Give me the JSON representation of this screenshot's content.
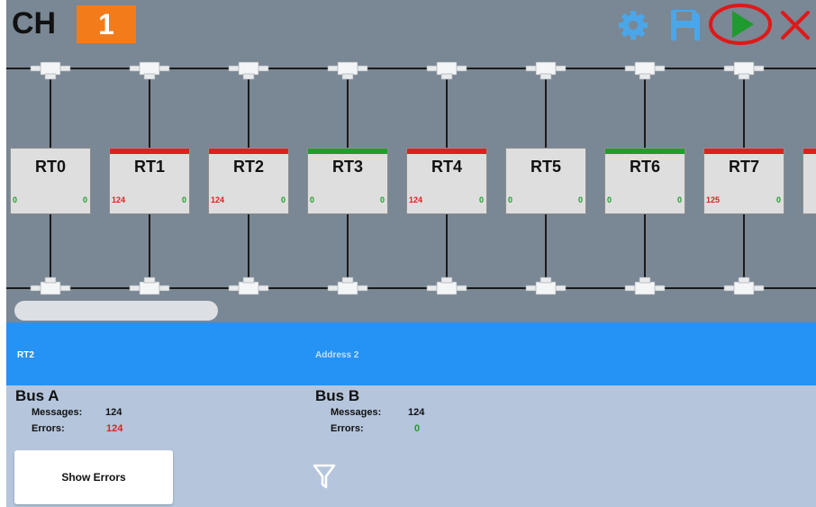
{
  "header": {
    "channel_label": "CH",
    "channel_number": "1",
    "icons": [
      "gear-icon",
      "save-icon",
      "play-icon",
      "close-icon"
    ]
  },
  "rts": [
    {
      "name": "RT0",
      "left_count": "0",
      "right_count": "0",
      "status": "none"
    },
    {
      "name": "RT1",
      "left_count": "124",
      "right_count": "0",
      "status": "error"
    },
    {
      "name": "RT2",
      "left_count": "124",
      "right_count": "0",
      "status": "error"
    },
    {
      "name": "RT3",
      "left_count": "0",
      "right_count": "0",
      "status": "ok"
    },
    {
      "name": "RT4",
      "left_count": "124",
      "right_count": "0",
      "status": "error"
    },
    {
      "name": "RT5",
      "left_count": "0",
      "right_count": "0",
      "status": "none"
    },
    {
      "name": "RT6",
      "left_count": "0",
      "right_count": "0",
      "status": "ok"
    },
    {
      "name": "RT7",
      "left_count": "125",
      "right_count": "0",
      "status": "error"
    }
  ],
  "selection": {
    "rt_name": "RT2",
    "address": "Address 2"
  },
  "bus_a": {
    "title": "Bus A",
    "messages_label": "Messages:",
    "messages_value": "124",
    "errors_label": "Errors:",
    "errors_value": "124"
  },
  "bus_b": {
    "title": "Bus B",
    "messages_label": "Messages:",
    "messages_value": "124",
    "errors_label": "Errors:",
    "errors_value": "0"
  },
  "actions": {
    "show_errors_label": "Show Errors",
    "filter_icon": "filter-icon"
  },
  "colors": {
    "error": "#e02020",
    "ok": "#1e9e2b",
    "selection_bar": "#2592f5",
    "channel_badge": "#f47b1a",
    "background": "#7a8794"
  }
}
